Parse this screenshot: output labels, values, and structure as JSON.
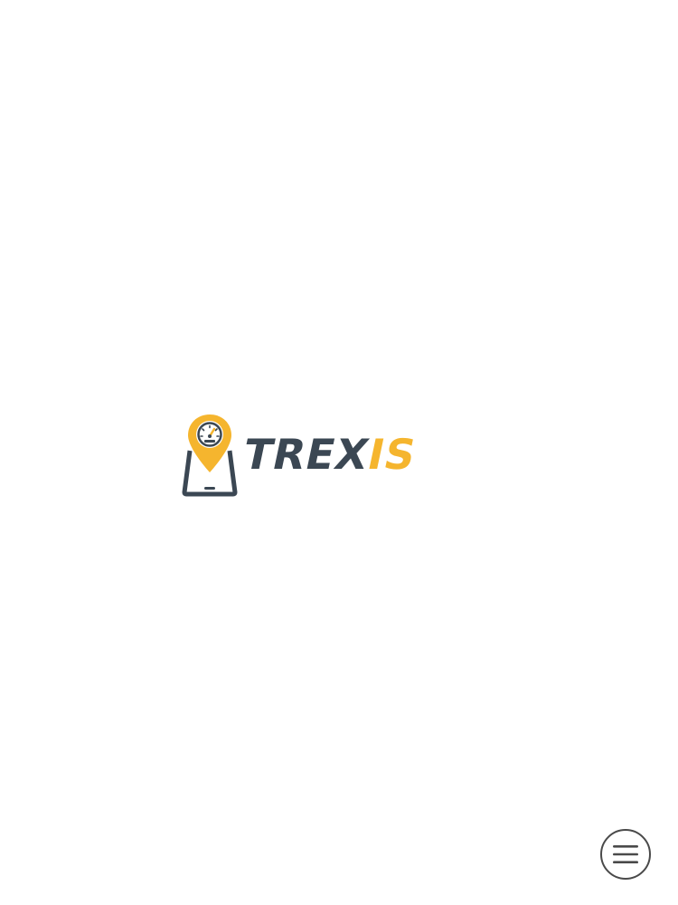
{
  "splash": {
    "logo": {
      "brand_primary": "TREX",
      "brand_accent": "IS",
      "mark_icon": "location-pin-speedometer-tablet-icon",
      "colors": {
        "primary": "#3b4753",
        "accent": "#f5b52e",
        "background": "#ffffff"
      }
    }
  },
  "menu_button": {
    "icon": "hamburger-menu-icon",
    "border_color": "#4a4a4a"
  }
}
